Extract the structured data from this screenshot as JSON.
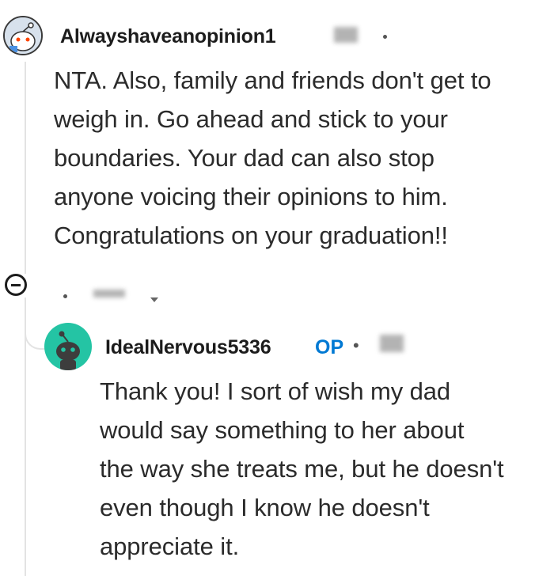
{
  "comments": [
    {
      "username": "Alwayshaveanopinion1",
      "body": "NTA. Also, family and friends don't get to\nweigh in. Go ahead and stick to your\nboundaries. Your dad can also stop\nanyone voicing their opinions to him.\nCongratulations on your graduation!!"
    },
    {
      "username": "IdealNervous5336",
      "op_badge": "OP",
      "separator": "•",
      "body": "Thank you! I sort of wish my dad\nwould say something to her about\nthe way she treats me, but he doesn't\neven though I know he doesn't\nappreciate it."
    }
  ],
  "colors": {
    "op_accent": "#0079d3",
    "thread_line": "#e3e3e3",
    "reply_avatar_bg": "#24c4a4"
  },
  "icons": [
    "reddit-snoo-avatar-icon",
    "collapse-thread-icon",
    "chevron-down-icon"
  ]
}
